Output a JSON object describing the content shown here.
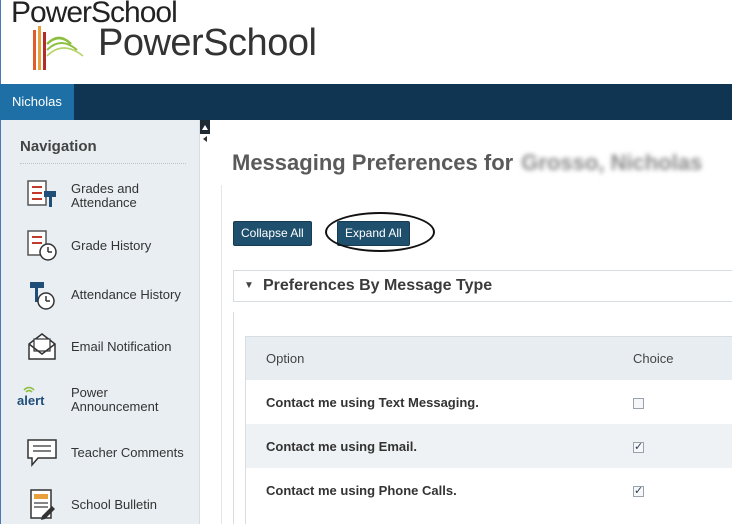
{
  "header": {
    "logo_small": "PowerSchool",
    "logo_big": "PowerSchool"
  },
  "topbar": {
    "user_tab": "Nicholas"
  },
  "sidebar": {
    "title": "Navigation",
    "items": [
      {
        "label": "Grades and Attendance",
        "icon": "grades-icon"
      },
      {
        "label": "Grade History",
        "icon": "grade-history-icon"
      },
      {
        "label": "Attendance History",
        "icon": "attendance-history-icon"
      },
      {
        "label": "Email Notification",
        "icon": "email-icon"
      },
      {
        "label": "Power Announcement",
        "icon": "alert-icon"
      },
      {
        "label": "Teacher Comments",
        "icon": "comments-icon"
      },
      {
        "label": "School Bulletin",
        "icon": "bulletin-icon"
      }
    ]
  },
  "main": {
    "title": "Messaging Preferences for",
    "title_name_blurred": "Grosso, Nicholas",
    "buttons": {
      "collapse_all": "Collapse All",
      "expand_all": "Expand All"
    },
    "section": {
      "title": "Preferences By Message Type"
    },
    "table": {
      "headers": [
        "Option",
        "Choice"
      ],
      "rows": [
        {
          "option": "Contact me using Text Messaging.",
          "checked": false
        },
        {
          "option": "Contact me using Email.",
          "checked": true
        },
        {
          "option": "Contact me using Phone Calls.",
          "checked": true
        }
      ]
    }
  },
  "colors": {
    "topbar": "#0f3553",
    "user_tab": "#1d6fa5",
    "button": "#1e506d",
    "sidebar": "#e9eef2"
  }
}
